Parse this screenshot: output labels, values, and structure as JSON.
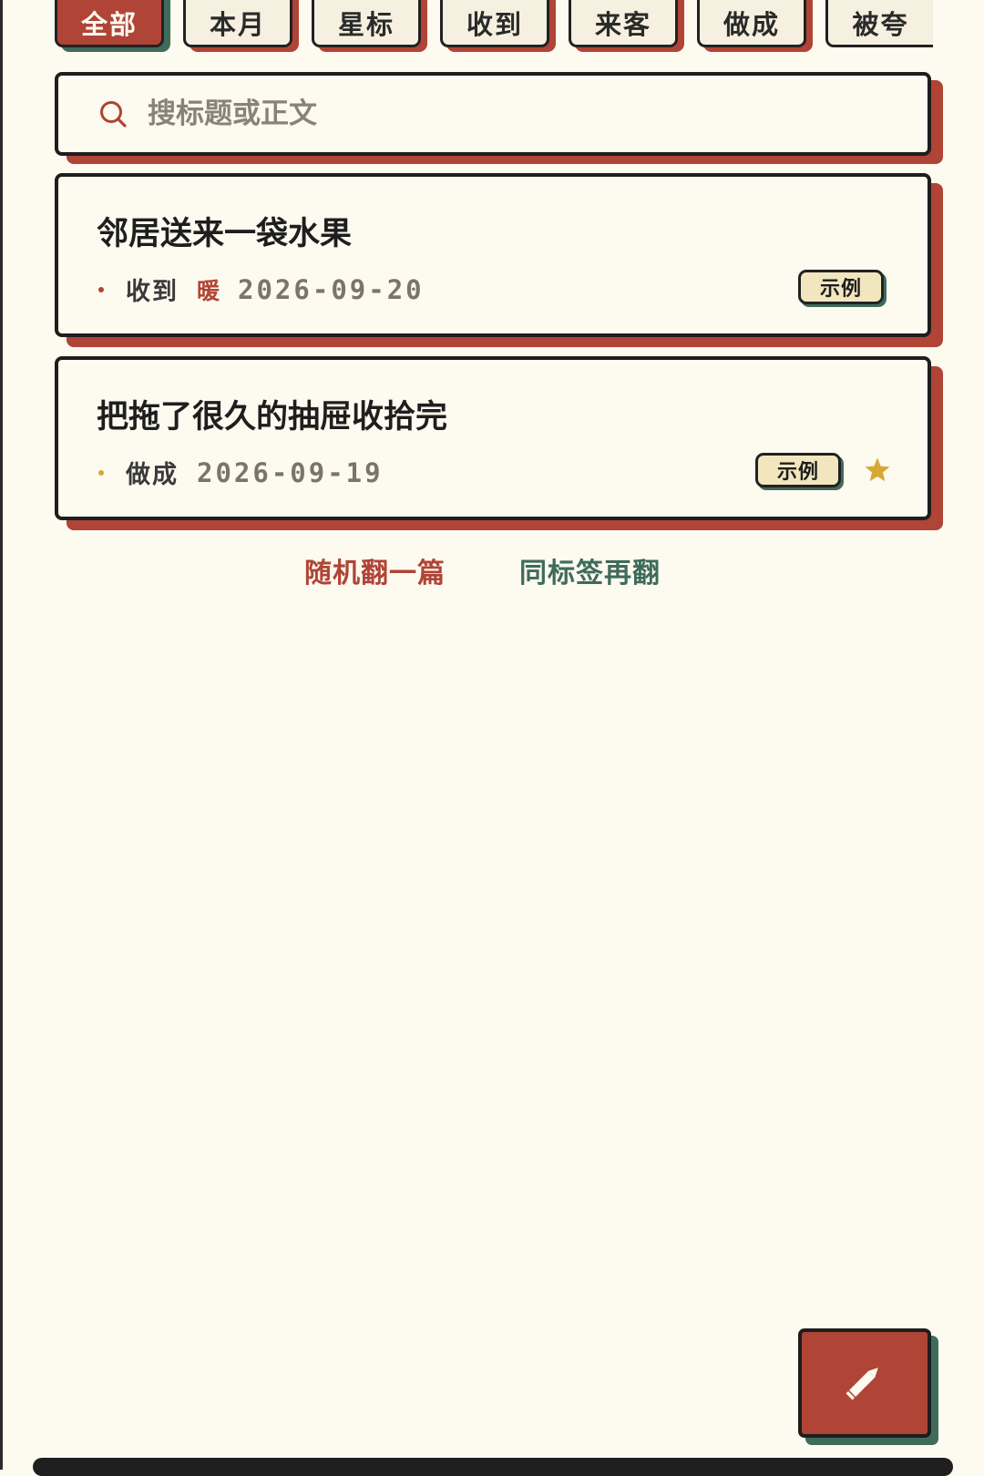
{
  "filters": [
    {
      "label": "全部",
      "active": true
    },
    {
      "label": "本月",
      "active": false
    },
    {
      "label": "星标",
      "active": false
    },
    {
      "label": "收到",
      "active": false
    },
    {
      "label": "来客",
      "active": false
    },
    {
      "label": "做成",
      "active": false
    },
    {
      "label": "被夸",
      "active": false
    }
  ],
  "search": {
    "placeholder": "搜标题或正文",
    "value": "",
    "icon": "search-icon"
  },
  "entries": [
    {
      "title": "邻居送来一袋水果",
      "tag": "收到",
      "mood": "暖",
      "date": "2026-09-20",
      "badge": "示例",
      "starred": false
    },
    {
      "title": "把拖了很久的抽屉收拾完",
      "tag": "做成",
      "mood": "",
      "date": "2026-09-19",
      "badge": "示例",
      "starred": true
    }
  ],
  "actions": {
    "random": "随机翻一篇",
    "same_tag": "同标签再翻"
  },
  "fab": {
    "icon": "pencil-icon"
  },
  "colors": {
    "background": "#fdfaf0",
    "accent_red": "#b04436",
    "accent_green": "#3f6b5b",
    "star": "#d8a735",
    "badge": "#f2e6bf",
    "ink": "#1e1e1e"
  }
}
